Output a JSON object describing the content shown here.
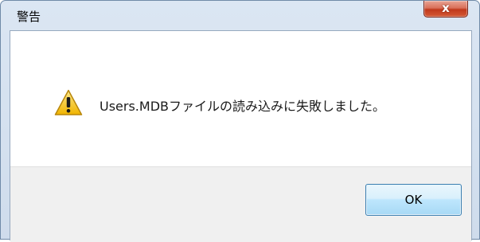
{
  "window": {
    "title": "警告"
  },
  "titlebar": {
    "close_glyph": "x"
  },
  "dialog": {
    "icon": "warning-icon",
    "message": "Users.MDBファイルの読み込みに失敗しました。",
    "ok_label": "OK"
  },
  "colors": {
    "close_button": "#c7432a",
    "warning_yellow": "#f5c518",
    "ok_button_border": "#3c7fb1",
    "button_area_bg": "#f0f0f0"
  }
}
